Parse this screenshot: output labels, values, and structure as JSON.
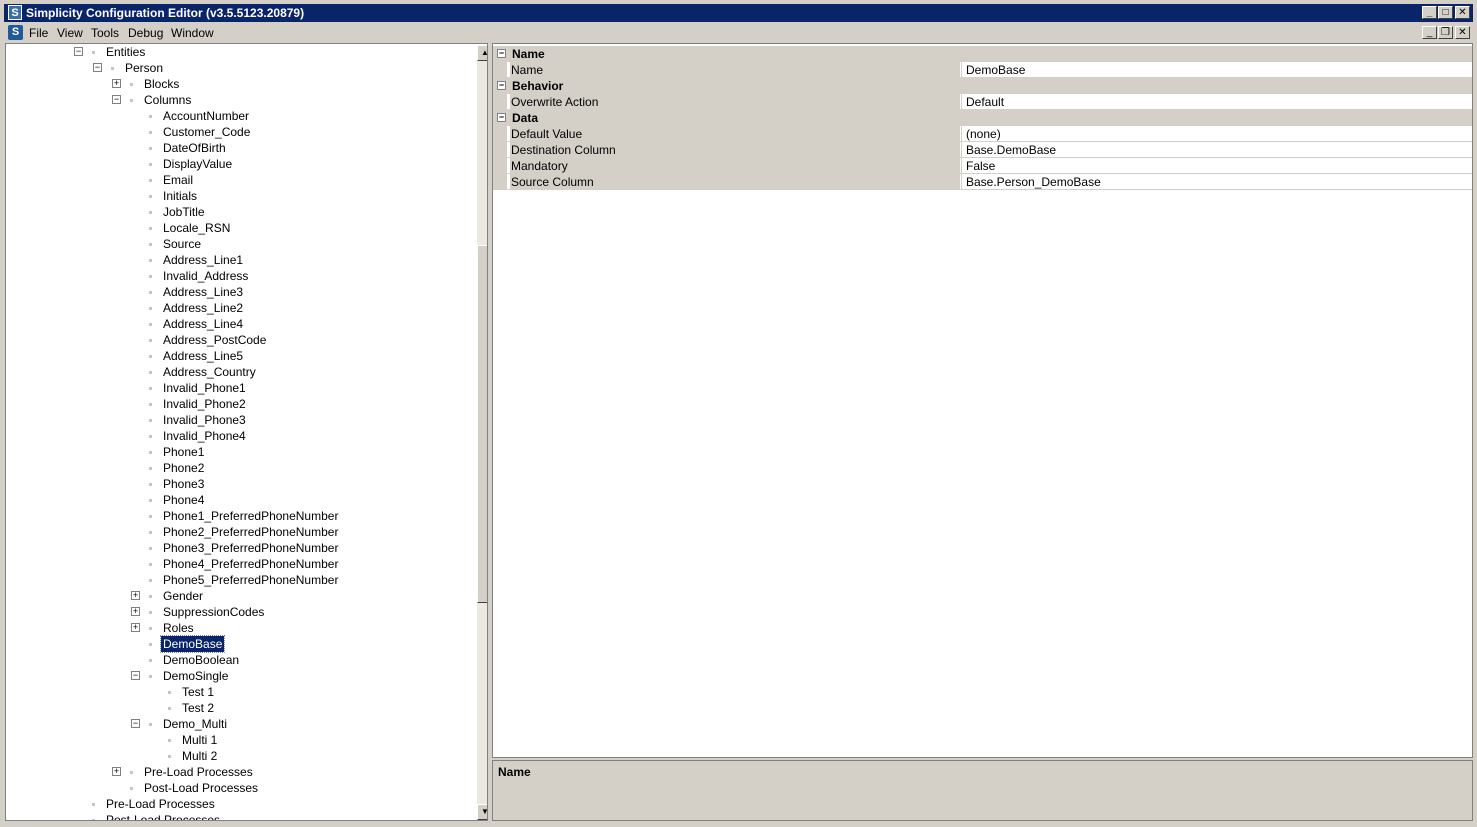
{
  "window": {
    "title": "Simplicity Configuration Editor (v3.5.5123.20879)"
  },
  "menu": [
    "File",
    "View",
    "Tools",
    "Debug",
    "Window"
  ],
  "tree": [
    {
      "label": "Entities",
      "level": 0,
      "expander": "-"
    },
    {
      "label": "Person",
      "level": 1,
      "expander": "-"
    },
    {
      "label": "Blocks",
      "level": 2,
      "expander": "+"
    },
    {
      "label": "Columns",
      "level": 2,
      "expander": "-"
    },
    {
      "label": "AccountNumber",
      "level": 3
    },
    {
      "label": "Customer_Code",
      "level": 3
    },
    {
      "label": "DateOfBirth",
      "level": 3
    },
    {
      "label": "DisplayValue",
      "level": 3
    },
    {
      "label": "Email",
      "level": 3
    },
    {
      "label": "Initials",
      "level": 3
    },
    {
      "label": "JobTitle",
      "level": 3
    },
    {
      "label": "Locale_RSN",
      "level": 3
    },
    {
      "label": "Source",
      "level": 3
    },
    {
      "label": "Address_Line1",
      "level": 3
    },
    {
      "label": "Invalid_Address",
      "level": 3
    },
    {
      "label": "Address_Line3",
      "level": 3
    },
    {
      "label": "Address_Line2",
      "level": 3
    },
    {
      "label": "Address_Line4",
      "level": 3
    },
    {
      "label": "Address_PostCode",
      "level": 3
    },
    {
      "label": "Address_Line5",
      "level": 3
    },
    {
      "label": "Address_Country",
      "level": 3
    },
    {
      "label": "Invalid_Phone1",
      "level": 3
    },
    {
      "label": "Invalid_Phone2",
      "level": 3
    },
    {
      "label": "Invalid_Phone3",
      "level": 3
    },
    {
      "label": "Invalid_Phone4",
      "level": 3
    },
    {
      "label": "Phone1",
      "level": 3
    },
    {
      "label": "Phone2",
      "level": 3
    },
    {
      "label": "Phone3",
      "level": 3
    },
    {
      "label": "Phone4",
      "level": 3
    },
    {
      "label": "Phone1_PreferredPhoneNumber",
      "level": 3
    },
    {
      "label": "Phone2_PreferredPhoneNumber",
      "level": 3
    },
    {
      "label": "Phone3_PreferredPhoneNumber",
      "level": 3
    },
    {
      "label": "Phone4_PreferredPhoneNumber",
      "level": 3
    },
    {
      "label": "Phone5_PreferredPhoneNumber",
      "level": 3
    },
    {
      "label": "Gender",
      "level": 3,
      "expander": "+"
    },
    {
      "label": "SuppressionCodes",
      "level": 3,
      "expander": "+"
    },
    {
      "label": "Roles",
      "level": 3,
      "expander": "+"
    },
    {
      "label": "DemoBase",
      "level": 3,
      "selected": true
    },
    {
      "label": "DemoBoolean",
      "level": 3
    },
    {
      "label": "DemoSingle",
      "level": 3,
      "expander": "-"
    },
    {
      "label": "Test 1",
      "level": 4
    },
    {
      "label": "Test 2",
      "level": 4
    },
    {
      "label": "Demo_Multi",
      "level": 3,
      "expander": "-"
    },
    {
      "label": "Multi 1",
      "level": 4
    },
    {
      "label": "Multi 2",
      "level": 4
    },
    {
      "label": "Pre-Load Processes",
      "level": 2,
      "expander": "+"
    },
    {
      "label": "Post-Load Processes",
      "level": 2
    },
    {
      "label": "Pre-Load Processes",
      "level": 0
    },
    {
      "label": "Post-Load Processes",
      "level": 0
    }
  ],
  "properties": [
    {
      "category": "Name",
      "rows": [
        {
          "name": "Name",
          "value": "DemoBase"
        }
      ]
    },
    {
      "category": "Behavior",
      "rows": [
        {
          "name": "Overwrite Action",
          "value": "Default"
        }
      ]
    },
    {
      "category": "Data",
      "rows": [
        {
          "name": "Default Value",
          "value": "(none)"
        },
        {
          "name": "Destination Column",
          "value": "Base.DemoBase"
        },
        {
          "name": "Mandatory",
          "value": "False"
        },
        {
          "name": "Source Column",
          "value": "Base.Person_DemoBase"
        }
      ]
    }
  ],
  "description": {
    "title": "Name"
  },
  "icons": {
    "app": "S",
    "minimize": "_",
    "maximize": "□",
    "close": "✕",
    "restore": "❐",
    "expand": "+",
    "collapse": "−",
    "scroll_up": "▲",
    "scroll_down": "▼"
  }
}
